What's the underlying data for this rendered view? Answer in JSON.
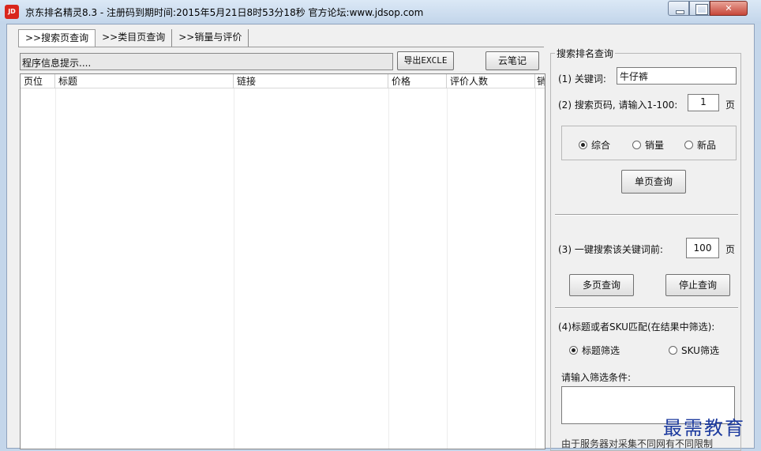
{
  "window": {
    "app_icon_text": "JD",
    "title": "京东排名精灵8.3 - 注册码到期时间:2015年5月21日8时53分18秒   官方论坛:www.jdsop.com"
  },
  "tabs": [
    ">>搜索页查询",
    ">>类目页查询",
    ">>销量与评价"
  ],
  "status": {
    "text": "程序信息提示...."
  },
  "buttons": {
    "export": "导出EXCLE",
    "cloud_notes": "云笔记",
    "single_page": "单页查询",
    "multi_page": "多页查询",
    "stop": "停止查询"
  },
  "table": {
    "columns": [
      "页位",
      "标题",
      "链接",
      "价格",
      "评价人数",
      "销"
    ]
  },
  "search_panel": {
    "legend": "搜索排名查询",
    "keyword_label": "(1) 关键词:",
    "keyword_value": "牛仔裤",
    "page_label": "(2) 搜索页码, 请输入1-100:",
    "page_value": "1",
    "page_unit": "页",
    "sort_options": [
      {
        "label": "综合",
        "selected": true
      },
      {
        "label": "销量",
        "selected": false
      },
      {
        "label": "新品",
        "selected": false
      }
    ],
    "multi_label": "(3) 一键搜索该关键词前:",
    "multi_value": "100",
    "multi_unit": "页",
    "filter_label": "(4)标题或者SKU匹配(在结果中筛选):",
    "filter_options": [
      {
        "label": "标题筛选",
        "selected": true
      },
      {
        "label": "SKU筛选",
        "selected": false
      }
    ],
    "filter_prompt": "请输入筛选条件:",
    "filter_value": "",
    "notice": "由于服务器对采集不同网有不同限制"
  },
  "watermark": "最需教育"
}
